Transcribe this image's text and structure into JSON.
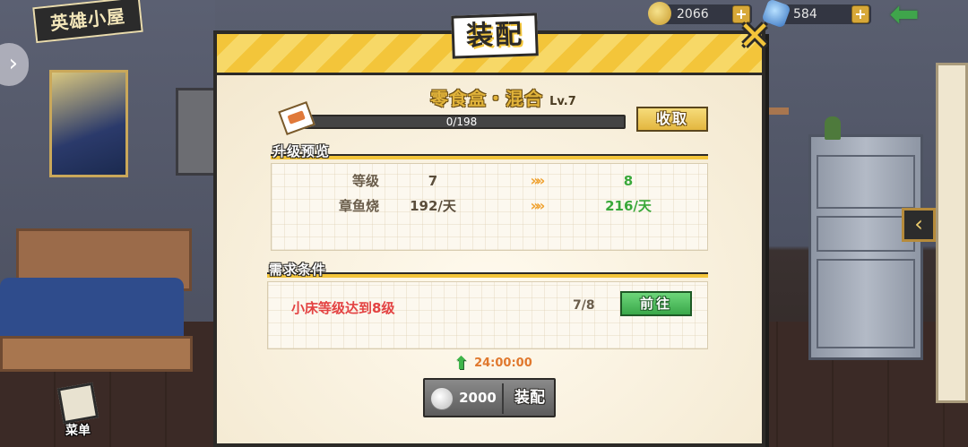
{
  "hud": {
    "house_title": "英雄小屋",
    "gold": "2066",
    "gems": "584",
    "plus_glyph": "+",
    "menu_label": "菜单",
    "icons": [
      "coin-icon",
      "gem-icon",
      "back-arrow-icon",
      "chevron-left-icon",
      "menu-notebook-icon",
      "expand-arrow-icon"
    ]
  },
  "dialog": {
    "title": "装配",
    "close_glyph": "✕",
    "item_name": "零食盒・混合",
    "item_level": "Lv.7",
    "progress": {
      "text": "0/198",
      "current": 0,
      "max": 198
    },
    "claim_label": "收取",
    "preview": {
      "section_title": "升级预览",
      "arrow_glyph": "»»",
      "rows": [
        {
          "label": "等级",
          "current": "7",
          "next": "8"
        },
        {
          "label": "章鱼烧",
          "current": "192/天",
          "next": "216/天"
        }
      ]
    },
    "requirements": {
      "section_title": "需求条件",
      "text": "小床等级达到8级",
      "count": "7/8",
      "go_label": "前往"
    },
    "timer": "24:00:00",
    "equip": {
      "cost": "2000",
      "label": "装配"
    }
  },
  "colors": {
    "accent_yellow": "#f3c53a",
    "green_value": "#39a83a",
    "red_requirement": "#e34242",
    "timer_orange": "#e0782d"
  }
}
